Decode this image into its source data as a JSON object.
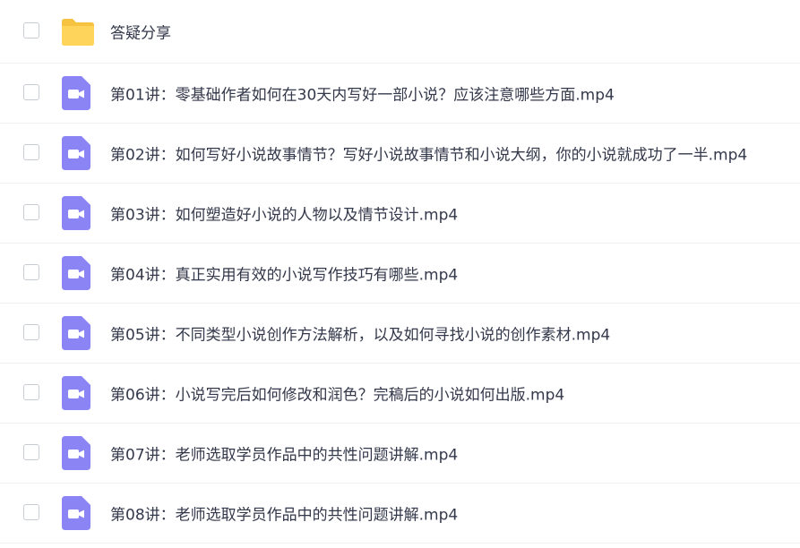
{
  "colors": {
    "folder": "#ffd45a",
    "folder_tab": "#f5c33f",
    "video": "#8b84f4",
    "video_symbol": "#ffffff",
    "text": "#33384a",
    "divider": "#eef0f4"
  },
  "files": [
    {
      "name": "答疑分享",
      "type": "folder",
      "icon": "folder-icon"
    },
    {
      "name": "第01讲：零基础作者如何在30天内写好一部小说？应该注意哪些方面.mp4",
      "type": "video",
      "icon": "video-file-icon"
    },
    {
      "name": "第02讲：如何写好小说故事情节？写好小说故事情节和小说大纲，你的小说就成功了一半.mp4",
      "type": "video",
      "icon": "video-file-icon"
    },
    {
      "name": "第03讲：如何塑造好小说的人物以及情节设计.mp4",
      "type": "video",
      "icon": "video-file-icon"
    },
    {
      "name": "第04讲：真正实用有效的小说写作技巧有哪些.mp4",
      "type": "video",
      "icon": "video-file-icon"
    },
    {
      "name": "第05讲：不同类型小说创作方法解析，以及如何寻找小说的创作素材.mp4",
      "type": "video",
      "icon": "video-file-icon"
    },
    {
      "name": "第06讲：小说写完后如何修改和润色？完稿后的小说如何出版.mp4",
      "type": "video",
      "icon": "video-file-icon"
    },
    {
      "name": "第07讲：老师选取学员作品中的共性问题讲解.mp4",
      "type": "video",
      "icon": "video-file-icon"
    },
    {
      "name": "第08讲：老师选取学员作品中的共性问题讲解.mp4",
      "type": "video",
      "icon": "video-file-icon"
    }
  ]
}
